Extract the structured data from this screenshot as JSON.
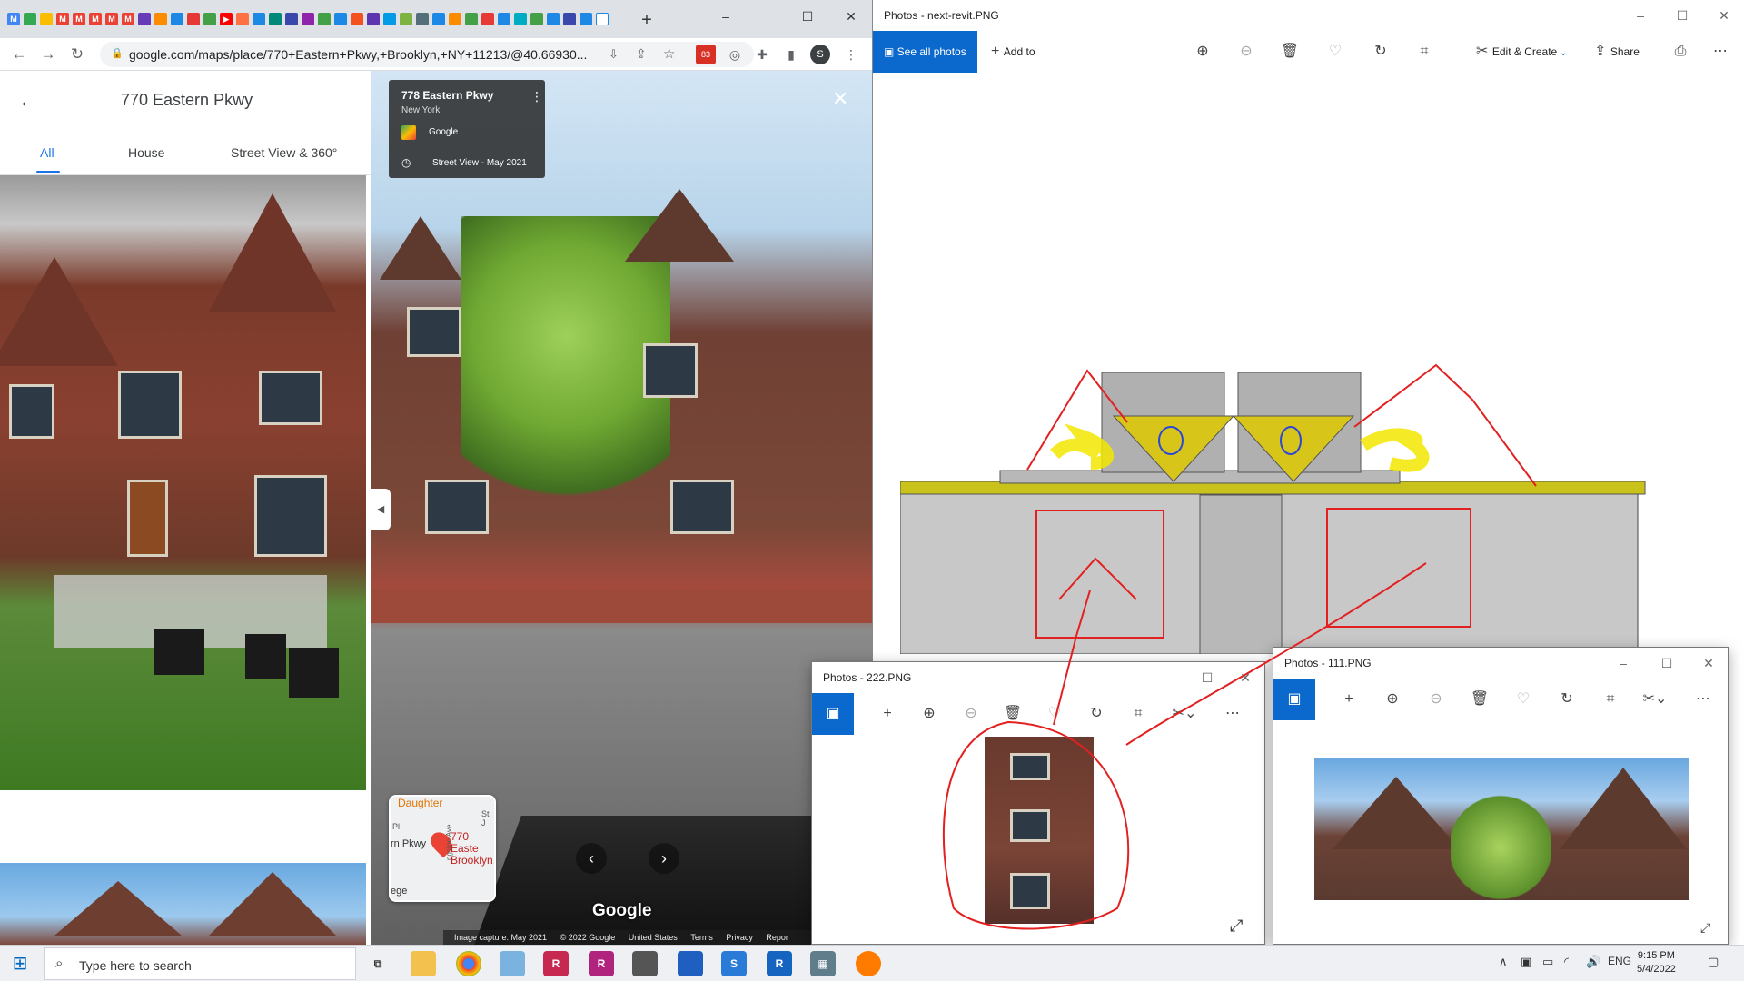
{
  "chrome": {
    "window_controls": {
      "minimize": "–",
      "maximize": "☐",
      "close": "✕"
    },
    "new_tab": "+",
    "url": "google.com/maps/place/770+Eastern+Pkwy,+Brooklyn,+NY+11213/@40.66930...",
    "profile_initial": "S",
    "badge_count": "83"
  },
  "maps": {
    "title": "770 Eastern Pkwy",
    "tabs": [
      "All",
      "House",
      "Street View & 360°"
    ]
  },
  "streetview": {
    "address": "778 Eastern Pkwy",
    "city": "New York",
    "provider": "Google",
    "date": "Street View - May 2021",
    "minimap": {
      "label_top": "Daughter",
      "label_st": "St J",
      "label_pl": "Pl",
      "label_street": "rn Pkwy",
      "label_place": "770 Easte Brooklyn,",
      "label_ave": "ngston Ave",
      "label_edge": "ege"
    },
    "brand": "Google",
    "footer": [
      "Image capture: May 2021",
      "© 2022 Google",
      "United States",
      "Terms",
      "Privacy",
      "Repor"
    ]
  },
  "photos_main": {
    "title": "Photos - next-revit.PNG",
    "see_all": "See all photos",
    "add_to": "Add to",
    "edit_create": "Edit & Create",
    "share": "Share"
  },
  "photos_222": {
    "title": "Photos - 222.PNG"
  },
  "photos_111": {
    "title": "Photos - 111.PNG"
  },
  "taskbar": {
    "search_placeholder": "Type here to search",
    "time": "9:15 PM",
    "date": "5/4/2022",
    "language": "ENG"
  },
  "colors": {
    "accent_blue": "#0b68cc",
    "maps_blue": "#1a73e8",
    "annotation_red": "#e32020",
    "annotation_yellow": "#f3e600"
  }
}
